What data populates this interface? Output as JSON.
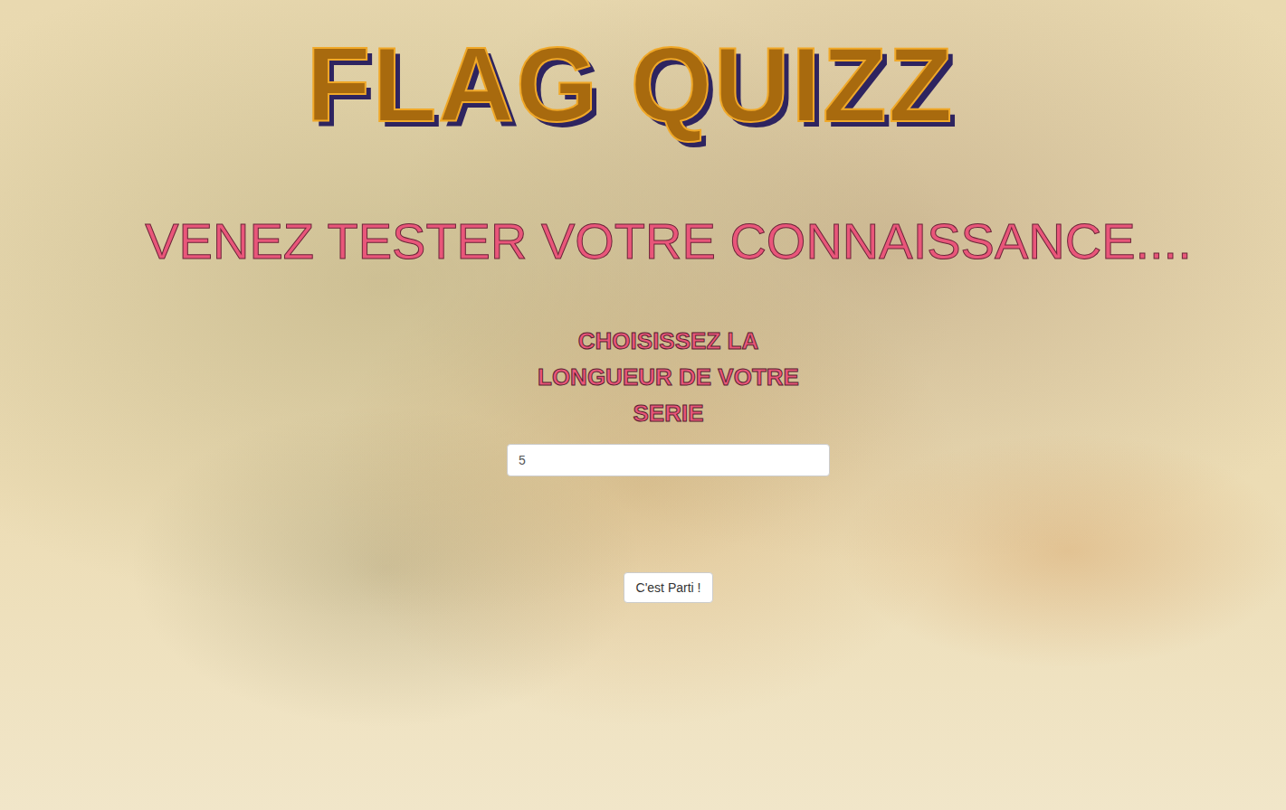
{
  "title": "FLAG QUIZZ",
  "subtitle": "VENEZ TESTER VOTRE CONNAISSANCE....",
  "series": {
    "label": "CHOISISSEZ LA LONGUEUR DE VOTRE SERIE",
    "value": "5"
  },
  "start_button": {
    "label": "C'est Parti !"
  }
}
